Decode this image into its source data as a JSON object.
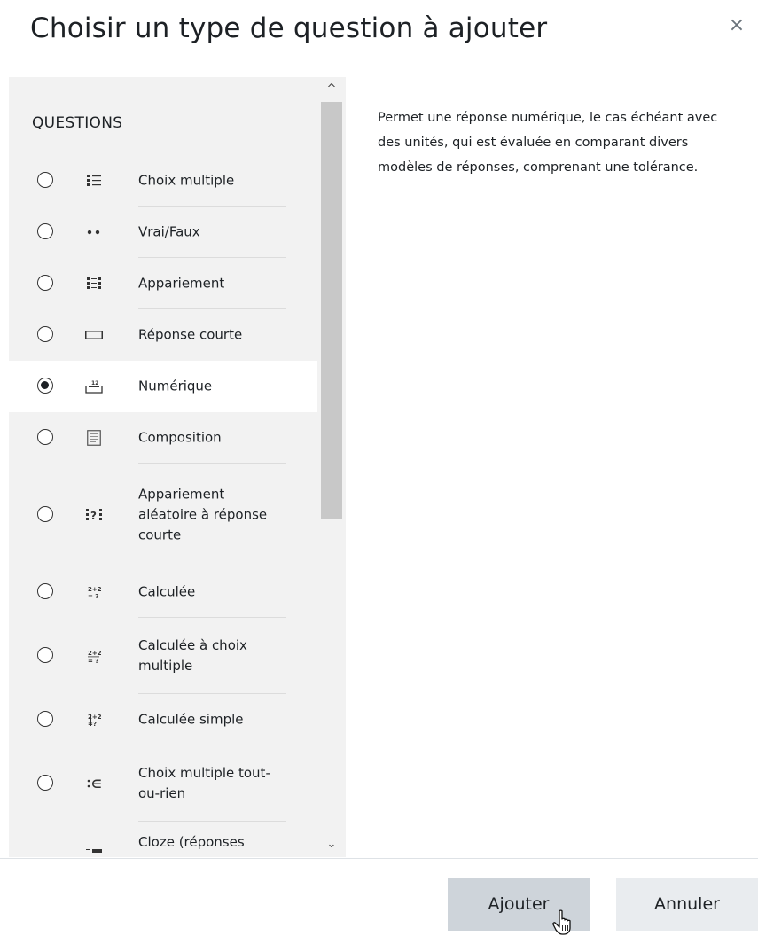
{
  "dialog": {
    "title": "Choisir un type de question à ajouter",
    "close_symbol": "×"
  },
  "section_heading": "QUESTIONS",
  "options": [
    {
      "label": "Choix multiple",
      "icon": "multichoice-icon",
      "selected": false
    },
    {
      "label": "Vrai/Faux",
      "icon": "truefalse-icon",
      "selected": false
    },
    {
      "label": "Appariement",
      "icon": "match-icon",
      "selected": false
    },
    {
      "label": "Réponse courte",
      "icon": "shortanswer-icon",
      "selected": false
    },
    {
      "label": "Numérique",
      "icon": "numerical-icon",
      "selected": true
    },
    {
      "label": "Composition",
      "icon": "essay-icon",
      "selected": false
    },
    {
      "label": "Appariement aléatoire à réponse courte",
      "icon": "randomsamatch-icon",
      "selected": false
    },
    {
      "label": "Calculée",
      "icon": "calculated-icon",
      "selected": false
    },
    {
      "label": "Calculée à choix multiple",
      "icon": "calculatedmulti-icon",
      "selected": false
    },
    {
      "label": "Calculée simple",
      "icon": "calculatedsimple-icon",
      "selected": false
    },
    {
      "label": "Choix multiple tout-ou-rien",
      "icon": "multichoiceset-icon",
      "selected": false
    },
    {
      "label": "Cloze (réponses",
      "icon": "multianswer-icon",
      "selected": false
    }
  ],
  "description": "Permet une réponse numérique, le cas échéant avec des unités, qui est évaluée en comparant divers modèles de réponses, comprenant une tolérance.",
  "buttons": {
    "add_label": "Ajouter",
    "cancel_label": "Annuler"
  },
  "scroll": {
    "up_symbol": "^",
    "down_symbol": "⌄"
  }
}
